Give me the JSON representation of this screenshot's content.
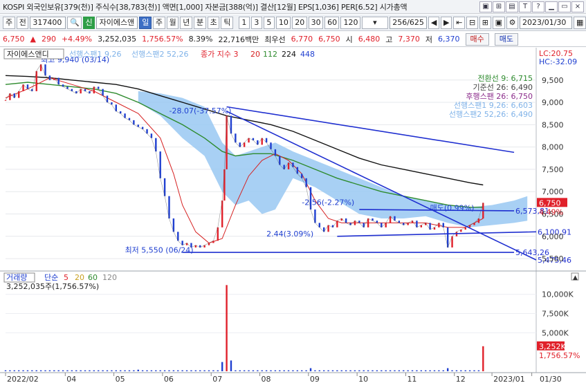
{
  "info_bar": {
    "text": "KOSPI 외국인보유[379(천)] 주식수[38,783(천)] 액면[1,000] 자본금[388(억)] 결산[12월] EPS[1,036] PER[6.52] 시가총액",
    "icons": [
      "dock-icon",
      "grid-icon",
      "table-icon",
      "text-t-icon",
      "help-icon",
      "minimize-icon",
      "restore-icon",
      "close-icon"
    ],
    "icon_glyphs": [
      "▣",
      "⊞",
      "▤",
      "T",
      "?",
      "▁",
      "▭",
      "×"
    ]
  },
  "toolbar": {
    "period_btn": "주",
    "market_select": "전",
    "code_value": "317400",
    "badge": "신",
    "stock_name": "자이에스앤",
    "tabs": [
      "일",
      "주",
      "월",
      "년",
      "분",
      "초",
      "틱"
    ],
    "active_tab": "일",
    "intervals": [
      "1",
      "3",
      "5",
      "10",
      "20",
      "30",
      "60",
      "120"
    ],
    "page_counter": "256/625",
    "date": "2023/01/30"
  },
  "price_row": {
    "price": "6,750",
    "change_arrow": "▲",
    "change": "290",
    "change_pct": "+4.49%",
    "volume": "3,252,035",
    "volume_pct": "1,756.57%",
    "turnover": "8.39%",
    "amount": "22,716백만",
    "prev_label": "최우선",
    "ask": "6,770",
    "bid": "6,750",
    "open_label": "시",
    "open": "6,480",
    "high_label": "고",
    "high": "7,370",
    "low_label": "저",
    "low": "6,370",
    "buy_button": "매수",
    "sell_button": "매도"
  },
  "colors": {
    "up": "#e0202a",
    "down": "#1f3fd0",
    "ma3": "#e0202a",
    "ma20": "#d62020",
    "ma112": "#2e8b2e",
    "ma224": "#111111",
    "ma448": "#1f3fd0",
    "cloud": "#99c8f2",
    "trendline": "#1f2fd0"
  },
  "chart_data": {
    "type": "line",
    "title": "자이에스앤디",
    "legend": {
      "name": "자이에스앤디",
      "span1": "선행스팬1 9,26",
      "span2": "선행스팬2 52,26",
      "ma_label": "종가 지수 3",
      "ma_periods": [
        "20",
        "112",
        "224",
        "448"
      ]
    },
    "top_right": {
      "lc": "LC:20.75",
      "hc": "HC:-32.09"
    },
    "ichimoku_labels": [
      "전환선 9: 6,715",
      "기준선 26: 6,490",
      "후행스팬 26: 6,750",
      "선행스팬1 9,26: 6,603",
      "선행스팬2 52,26: 6,490"
    ],
    "ylim": [
      5300,
      10100
    ],
    "y_ticks": [
      5500,
      6000,
      6500,
      7000,
      7500,
      8000,
      8500,
      9000,
      9500
    ],
    "y_tick_labels": [
      "5,500",
      "6,000",
      "6,500",
      "7,000",
      "7,500",
      "8,000",
      "8,500",
      "9,000",
      "9,500"
    ],
    "x_ticks": [
      "2022/02",
      "04",
      "05",
      "06",
      "07",
      "08",
      "09",
      "10",
      "11",
      "12",
      "2023/01",
      "01/30"
    ],
    "current_price": {
      "value": 6750,
      "label": "6,750",
      "pct": "4.49%"
    },
    "close": [
      [
        0,
        9050
      ],
      [
        2,
        9200
      ],
      [
        4,
        9100
      ],
      [
        6,
        9250
      ],
      [
        8,
        9400
      ],
      [
        10,
        9300
      ],
      [
        12,
        9250
      ],
      [
        14,
        9700
      ],
      [
        16,
        9850
      ],
      [
        18,
        9600
      ],
      [
        20,
        9500
      ],
      [
        22,
        9550
      ],
      [
        24,
        9400
      ],
      [
        26,
        9350
      ],
      [
        28,
        9300
      ],
      [
        30,
        9250
      ],
      [
        32,
        9200
      ],
      [
        34,
        9300
      ],
      [
        36,
        9250
      ],
      [
        38,
        9200
      ],
      [
        40,
        9350
      ],
      [
        42,
        9300
      ],
      [
        44,
        9150
      ],
      [
        46,
        9000
      ],
      [
        48,
        8950
      ],
      [
        50,
        8800
      ],
      [
        52,
        8750
      ],
      [
        54,
        8650
      ],
      [
        56,
        8600
      ],
      [
        58,
        8500
      ],
      [
        60,
        8450
      ],
      [
        62,
        8400
      ],
      [
        64,
        8300
      ],
      [
        66,
        8200
      ],
      [
        68,
        7900
      ],
      [
        70,
        7300
      ],
      [
        72,
        6900
      ],
      [
        74,
        6400
      ],
      [
        76,
        6100
      ],
      [
        78,
        5900
      ],
      [
        80,
        5800
      ],
      [
        82,
        5850
      ],
      [
        84,
        5750
      ],
      [
        86,
        5800
      ],
      [
        88,
        5750
      ],
      [
        90,
        5800
      ],
      [
        92,
        5850
      ],
      [
        94,
        5900
      ],
      [
        96,
        6200
      ],
      [
        98,
        6800
      ],
      [
        99,
        7500
      ],
      [
        100,
        8700
      ],
      [
        102,
        8300
      ],
      [
        104,
        8100
      ],
      [
        106,
        8000
      ],
      [
        108,
        8100
      ],
      [
        110,
        8200
      ],
      [
        112,
        8150
      ],
      [
        114,
        8050
      ],
      [
        116,
        8200
      ],
      [
        118,
        8100
      ],
      [
        120,
        7950
      ],
      [
        122,
        7800
      ],
      [
        124,
        7600
      ],
      [
        126,
        7500
      ],
      [
        128,
        7650
      ],
      [
        130,
        7550
      ],
      [
        132,
        7400
      ],
      [
        134,
        7300
      ],
      [
        136,
        7100
      ],
      [
        138,
        6600
      ],
      [
        140,
        6300
      ],
      [
        142,
        6200
      ],
      [
        144,
        6100
      ],
      [
        146,
        6250
      ],
      [
        148,
        6200
      ],
      [
        150,
        6350
      ],
      [
        152,
        6400
      ],
      [
        154,
        6300
      ],
      [
        156,
        6250
      ],
      [
        158,
        6350
      ],
      [
        160,
        6300
      ],
      [
        162,
        6200
      ],
      [
        164,
        6400
      ],
      [
        166,
        6350
      ],
      [
        168,
        6300
      ],
      [
        170,
        6200
      ],
      [
        172,
        6300
      ],
      [
        174,
        6450
      ],
      [
        176,
        6350
      ],
      [
        178,
        6300
      ],
      [
        180,
        6250
      ],
      [
        182,
        6300
      ],
      [
        184,
        6350
      ],
      [
        186,
        6200
      ],
      [
        188,
        6250
      ],
      [
        190,
        6300
      ],
      [
        192,
        6150
      ],
      [
        194,
        6200
      ],
      [
        196,
        6300
      ],
      [
        198,
        6200
      ],
      [
        200,
        5750
      ],
      [
        202,
        6000
      ],
      [
        204,
        6100
      ],
      [
        206,
        6150
      ],
      [
        208,
        6200
      ],
      [
        210,
        6250
      ],
      [
        212,
        6300
      ],
      [
        214,
        6400
      ],
      [
        216,
        6750
      ]
    ],
    "ma20": [
      [
        0,
        9100
      ],
      [
        10,
        9300
      ],
      [
        20,
        9550
      ],
      [
        30,
        9400
      ],
      [
        40,
        9250
      ],
      [
        50,
        9000
      ],
      [
        60,
        8750
      ],
      [
        70,
        8200
      ],
      [
        76,
        7400
      ],
      [
        80,
        6700
      ],
      [
        86,
        6100
      ],
      [
        92,
        5850
      ],
      [
        98,
        5950
      ],
      [
        104,
        6700
      ],
      [
        110,
        7350
      ],
      [
        116,
        7700
      ],
      [
        122,
        7850
      ],
      [
        128,
        7700
      ],
      [
        134,
        7400
      ],
      [
        140,
        6800
      ],
      [
        146,
        6400
      ],
      [
        152,
        6300
      ],
      [
        160,
        6300
      ],
      [
        170,
        6300
      ],
      [
        180,
        6300
      ],
      [
        190,
        6300
      ],
      [
        200,
        6200
      ],
      [
        208,
        6200
      ],
      [
        216,
        6400
      ]
    ],
    "ma112": [
      [
        0,
        9400
      ],
      [
        10,
        9450
      ],
      [
        20,
        9400
      ],
      [
        30,
        9350
      ],
      [
        40,
        9300
      ],
      [
        50,
        9200
      ],
      [
        60,
        9000
      ],
      [
        70,
        8750
      ],
      [
        80,
        8500
      ],
      [
        90,
        8200
      ],
      [
        98,
        7900
      ],
      [
        104,
        7800
      ],
      [
        112,
        7850
      ],
      [
        120,
        7850
      ],
      [
        130,
        7700
      ],
      [
        140,
        7500
      ],
      [
        150,
        7300
      ],
      [
        160,
        7150
      ],
      [
        170,
        7000
      ],
      [
        180,
        6900
      ],
      [
        190,
        6800
      ],
      [
        200,
        6700
      ],
      [
        210,
        6650
      ],
      [
        216,
        6650
      ]
    ],
    "ma224": [
      [
        0,
        9600
      ],
      [
        10,
        9580
      ],
      [
        20,
        9550
      ],
      [
        30,
        9500
      ],
      [
        40,
        9450
      ],
      [
        50,
        9400
      ],
      [
        60,
        9300
      ],
      [
        70,
        9150
      ],
      [
        80,
        9000
      ],
      [
        90,
        8850
      ],
      [
        100,
        8700
      ],
      [
        110,
        8600
      ],
      [
        120,
        8500
      ],
      [
        130,
        8350
      ],
      [
        140,
        8150
      ],
      [
        150,
        7950
      ],
      [
        160,
        7750
      ],
      [
        170,
        7600
      ],
      [
        180,
        7500
      ],
      [
        190,
        7400
      ],
      [
        200,
        7300
      ],
      [
        210,
        7200
      ],
      [
        216,
        7150
      ]
    ],
    "cloud_top": [
      [
        60,
        9250
      ],
      [
        70,
        9200
      ],
      [
        80,
        9100
      ],
      [
        90,
        8900
      ],
      [
        98,
        8100
      ],
      [
        104,
        7800
      ],
      [
        110,
        7900
      ],
      [
        116,
        8000
      ],
      [
        122,
        8100
      ],
      [
        130,
        7900
      ],
      [
        140,
        7700
      ],
      [
        150,
        7500
      ],
      [
        160,
        7300
      ],
      [
        170,
        7100
      ],
      [
        180,
        6900
      ],
      [
        190,
        6800
      ],
      [
        200,
        6700
      ],
      [
        210,
        6650
      ],
      [
        220,
        6700
      ],
      [
        230,
        6800
      ],
      [
        236,
        6900
      ]
    ],
    "cloud_bottom": [
      [
        60,
        9000
      ],
      [
        70,
        8700
      ],
      [
        80,
        8200
      ],
      [
        90,
        7800
      ],
      [
        98,
        7000
      ],
      [
        104,
        6700
      ],
      [
        110,
        6800
      ],
      [
        116,
        6500
      ],
      [
        122,
        6600
      ],
      [
        130,
        7300
      ],
      [
        140,
        7100
      ],
      [
        150,
        6800
      ],
      [
        160,
        6500
      ],
      [
        170,
        6400
      ],
      [
        180,
        6400
      ],
      [
        190,
        6450
      ],
      [
        200,
        6300
      ],
      [
        210,
        6200
      ],
      [
        220,
        6250
      ],
      [
        230,
        6300
      ],
      [
        236,
        6350
      ]
    ],
    "trendlines": [
      {
        "name": "upper",
        "from": [
          100,
          8900
        ],
        "to": [
          230,
          7880
        ]
      },
      {
        "name": "falling",
        "from": [
          100,
          8800
        ],
        "to": [
          240,
          5470
        ],
        "label": "5,475,46"
      },
      {
        "name": "support",
        "from": [
          150,
          6000
        ],
        "to": [
          240,
          6100
        ],
        "label": "6,100,91"
      },
      {
        "name": "flat",
        "from": [
          80,
          5640
        ],
        "to": [
          230,
          5640
        ],
        "label": "5,643,26"
      },
      {
        "name": "resistance",
        "from": [
          160,
          6600
        ],
        "to": [
          230,
          6570
        ],
        "label": "6,573,81"
      }
    ],
    "annotations": [
      {
        "text": "최고 9,940 (03/14)",
        "x": 16,
        "y": 9900
      },
      {
        "text": "-28.07(-37.57%)",
        "x": 74,
        "y": 8750
      },
      {
        "text": "-2.56(-2.27%)",
        "x": 134,
        "y": 6700
      },
      {
        "text": "2.44(3.09%)",
        "x": 118,
        "y": 6000
      },
      {
        "text": "최저 5,550 (06/24)",
        "x": 54,
        "y": 5630
      },
      {
        "text": "매도(0.99%)",
        "x": 192,
        "y": 6580
      }
    ],
    "volume_legend": {
      "name": "거래량",
      "ma_label": "단순",
      "periods": [
        "5",
        "20",
        "60",
        "120"
      ]
    },
    "volume_value": "3,252,035주(1,756.57%)",
    "volume_ticks": [
      "10,000K",
      "7,500K",
      "5,000K"
    ],
    "volume_ticks_values": [
      10000,
      7500,
      5000
    ],
    "volume_current": {
      "value": 3252,
      "label": "3,252K",
      "pct": "1,756.57%"
    },
    "volume_ylim": [
      0,
      11500
    ],
    "volume_spikes": [
      [
        100,
        11200
      ],
      [
        98,
        1200
      ],
      [
        102,
        1400
      ],
      [
        216,
        3252
      ],
      [
        60,
        200
      ],
      [
        138,
        400
      ],
      [
        200,
        400
      ]
    ]
  }
}
